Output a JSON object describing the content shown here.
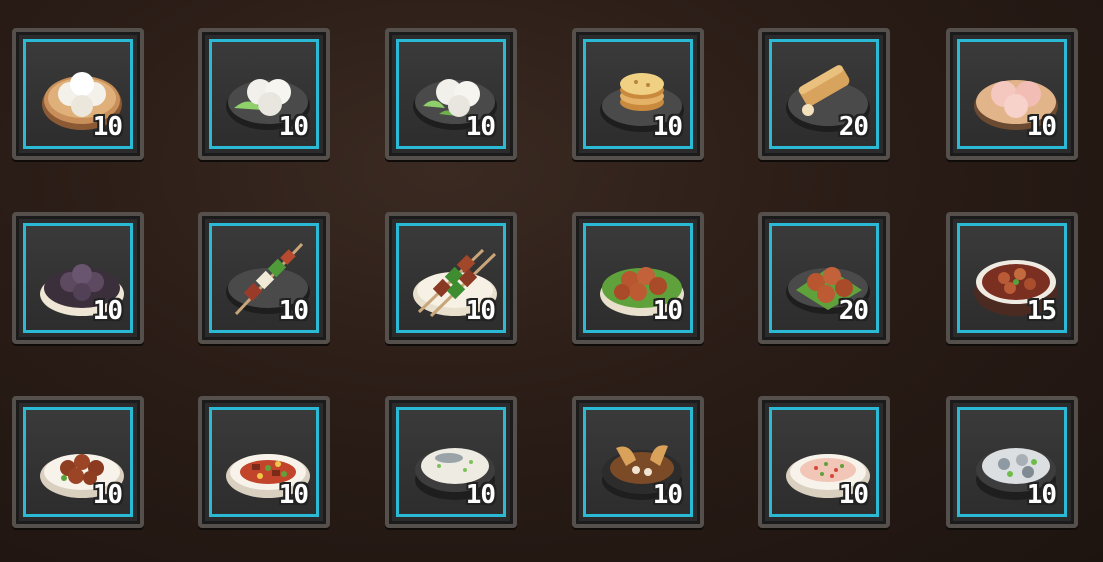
{
  "inventory": {
    "slots": [
      {
        "item": "steamed-buns-basket-icon",
        "count": "10"
      },
      {
        "item": "bok-choy-buns-plate-icon",
        "count": "10"
      },
      {
        "item": "bok-choy-buns-plate-icon",
        "count": "10"
      },
      {
        "item": "pancake-stack-plate-icon",
        "count": "10"
      },
      {
        "item": "spring-roll-plate-icon",
        "count": "20"
      },
      {
        "item": "pink-buns-plate-icon",
        "count": "10"
      },
      {
        "item": "purple-buns-plate-icon",
        "count": "10"
      },
      {
        "item": "meat-skewer-plate-icon",
        "count": "10"
      },
      {
        "item": "veggie-skewers-plate-icon",
        "count": "10"
      },
      {
        "item": "meatballs-bowl-icon",
        "count": "10"
      },
      {
        "item": "meatballs-lettuce-plate-icon",
        "count": "20"
      },
      {
        "item": "braised-meat-bowl-icon",
        "count": "15"
      },
      {
        "item": "meatballs-white-plate-icon",
        "count": "10"
      },
      {
        "item": "stir-fry-plate-icon",
        "count": "10"
      },
      {
        "item": "fish-soup-bowl-icon",
        "count": "10"
      },
      {
        "item": "roast-chicken-pot-icon",
        "count": "10"
      },
      {
        "item": "fried-rice-plate-icon",
        "count": "10"
      },
      {
        "item": "seafood-stew-bowl-icon",
        "count": "10"
      }
    ]
  },
  "colors": {
    "frame_accent": "#2bbad6",
    "frame_border": "#55504c"
  }
}
